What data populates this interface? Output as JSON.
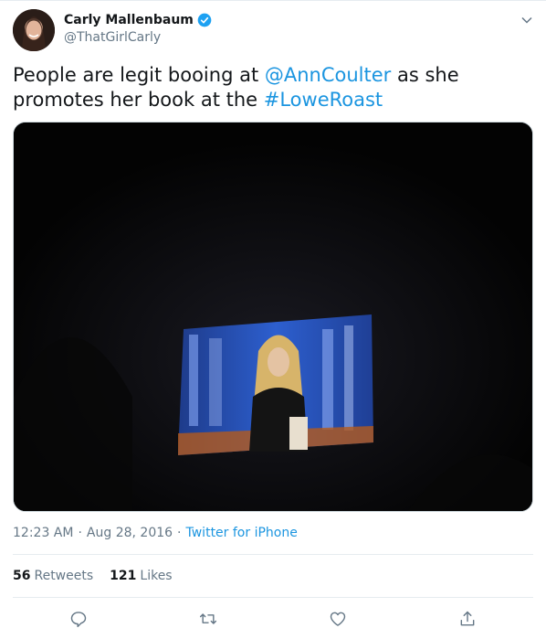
{
  "author": {
    "display_name": "Carly Mallenbaum",
    "handle": "@ThatGirlCarly",
    "verified": true
  },
  "tweet": {
    "text_parts": [
      {
        "type": "text",
        "value": "People are legit booing at "
      },
      {
        "type": "link",
        "value": "@AnnCoulter"
      },
      {
        "type": "text",
        "value": " as she promotes her book at the "
      },
      {
        "type": "link",
        "value": "#LoweRoast"
      }
    ],
    "time": "12:23 AM",
    "date": "Aug 28, 2016",
    "source": "Twitter for iPhone"
  },
  "stats": {
    "retweets_count": "56",
    "retweets_label": "Retweets",
    "likes_count": "121",
    "likes_label": "Likes"
  },
  "actions": [
    "reply-icon",
    "retweet-icon",
    "like-icon",
    "share-icon"
  ],
  "colors": {
    "link": "#1b95e0",
    "secondary_text": "#657786",
    "verified": "#1da1f2"
  }
}
